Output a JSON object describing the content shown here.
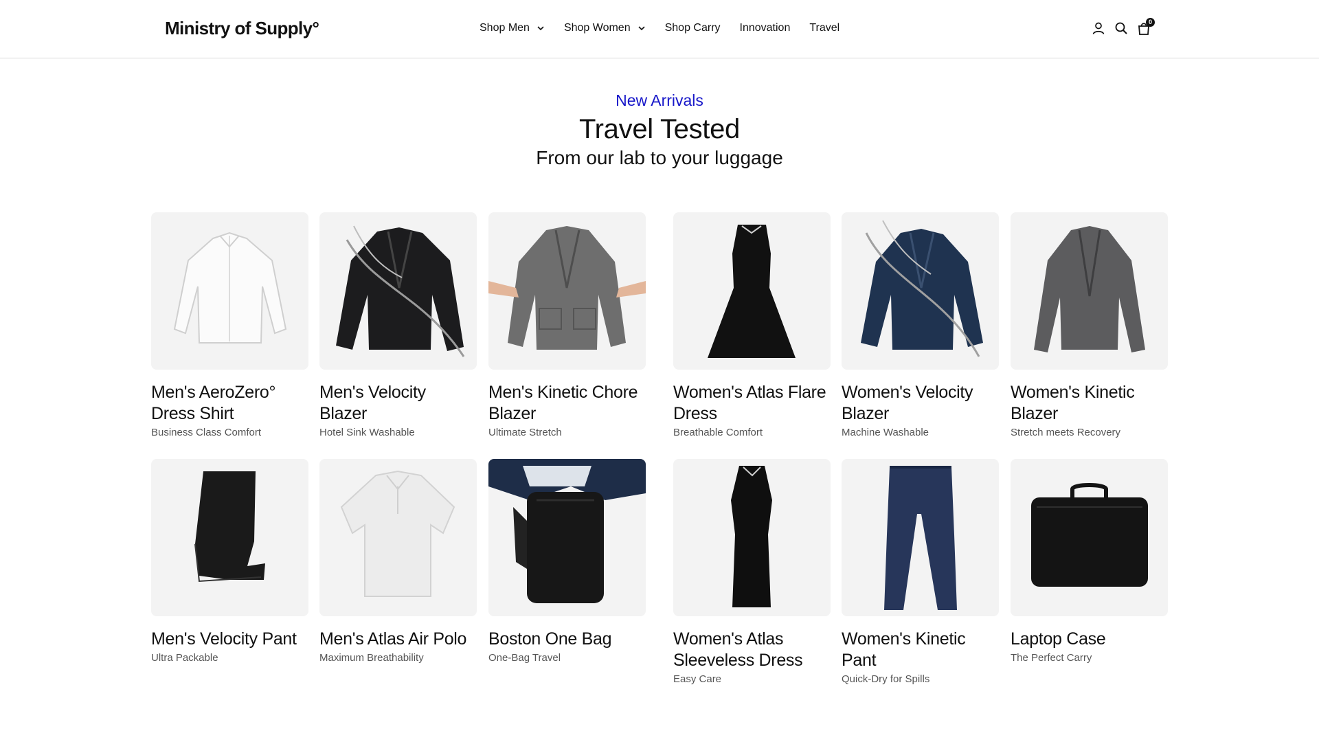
{
  "header": {
    "logo": "Ministry of Supply°",
    "nav": [
      {
        "label": "Shop Men",
        "has_dropdown": true
      },
      {
        "label": "Shop Women",
        "has_dropdown": true
      },
      {
        "label": "Shop Carry",
        "has_dropdown": false
      },
      {
        "label": "Innovation",
        "has_dropdown": false
      },
      {
        "label": "Travel",
        "has_dropdown": false
      }
    ],
    "icons": [
      "account-icon",
      "search-icon",
      "cart-icon"
    ],
    "cart_count": "0"
  },
  "hero": {
    "eyebrow": "New Arrivals",
    "title": "Travel Tested",
    "subtitle": "From our lab to your luggage"
  },
  "colors": {
    "accent": "#1717c9",
    "text": "#111111",
    "muted": "#555555",
    "card_bg": "#f3f3f3"
  },
  "products": [
    {
      "name": "Men's AeroZero° Dress Shirt",
      "tagline": "Business Class Comfort",
      "image": "white-shirt"
    },
    {
      "name": "Men's Velocity Blazer",
      "tagline": "Hotel Sink Washable",
      "image": "black-blazer-splash"
    },
    {
      "name": "Men's Kinetic Chore Blazer",
      "tagline": "Ultimate Stretch",
      "image": "gray-chore-blazer"
    },
    {
      "name": "Women's Atlas Flare Dress",
      "tagline": "Breathable Comfort",
      "image": "black-flare-dress"
    },
    {
      "name": "Women's Velocity Blazer",
      "tagline": "Machine Washable",
      "image": "navy-blazer-splash"
    },
    {
      "name": "Women's Kinetic Blazer",
      "tagline": "Stretch meets Recovery",
      "image": "gray-blazer"
    },
    {
      "name": "Men's Velocity Pant",
      "tagline": "Ultra Packable",
      "image": "black-pant"
    },
    {
      "name": "Men's Atlas Air Polo",
      "tagline": "Maximum Breathability",
      "image": "white-polo"
    },
    {
      "name": "Boston One Bag",
      "tagline": "One-Bag Travel",
      "image": "black-backpack"
    },
    {
      "name": "Women's Atlas Sleeveless Dress",
      "tagline": "Easy Care",
      "image": "black-sleeveless-dress"
    },
    {
      "name": "Women's Kinetic Pant",
      "tagline": "Quick-Dry for Spills",
      "image": "navy-pant"
    },
    {
      "name": "Laptop Case",
      "tagline": "The Perfect Carry",
      "image": "black-laptop-case"
    }
  ]
}
